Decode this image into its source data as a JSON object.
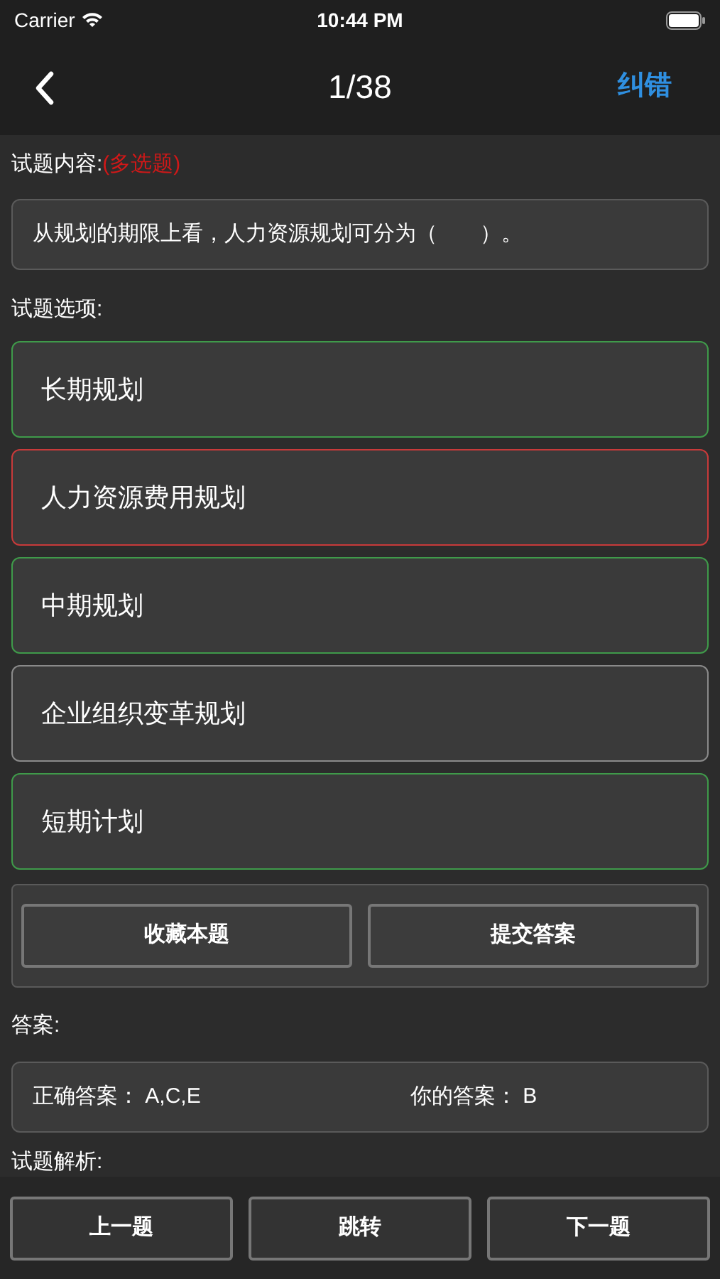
{
  "status_bar": {
    "carrier": "Carrier",
    "time": "10:44 PM"
  },
  "nav": {
    "title": "1/38",
    "action": "纠错"
  },
  "question": {
    "label": "试题内容:",
    "type_tag": "(多选题)",
    "text": "从规划的期限上看，人力资源规划可分为（　　）。"
  },
  "options_label": "试题选项:",
  "options": [
    {
      "text": "长期规划",
      "color": "#3f9a4a"
    },
    {
      "text": "人力资源费用规划",
      "color": "#c83a3a"
    },
    {
      "text": "中期规划",
      "color": "#3f9a4a"
    },
    {
      "text": "企业组织变革规划",
      "color": "#8a8a8a"
    },
    {
      "text": "短期计划",
      "color": "#3f9a4a"
    }
  ],
  "actions": [
    "收藏本题",
    "提交答案"
  ],
  "answer": {
    "label": "答案:",
    "correct_label": "正确答案：",
    "correct_value": "A,C,E",
    "yours_label": "你的答案：",
    "yours_value": "B"
  },
  "analysis_label": "试题解析:",
  "bottom_buttons": [
    "上一题",
    "跳转",
    "下一题"
  ]
}
